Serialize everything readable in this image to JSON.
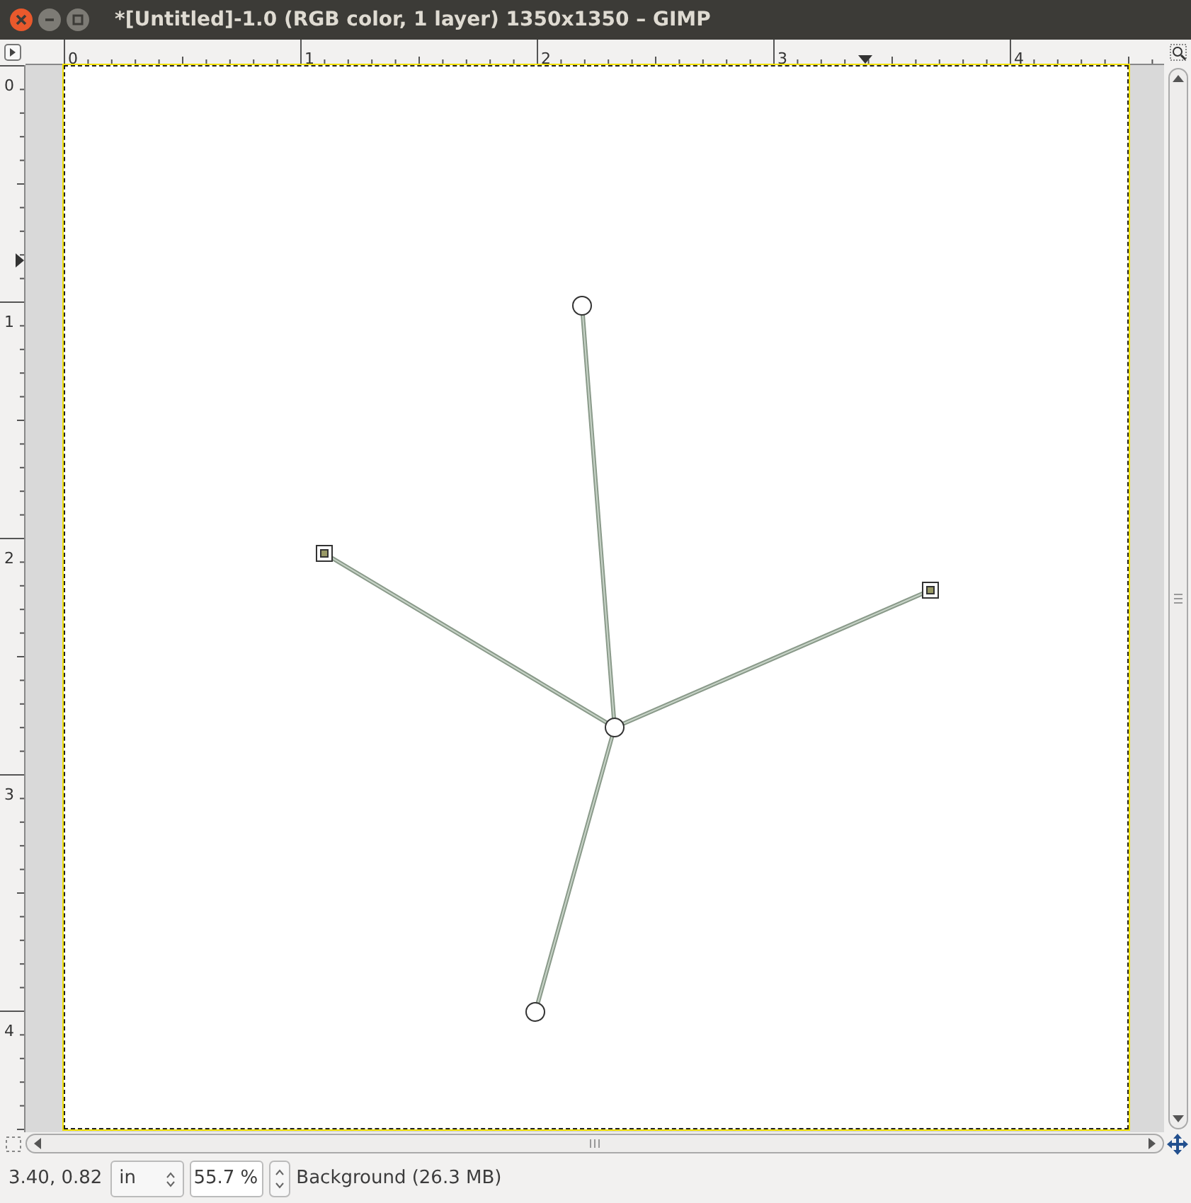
{
  "window": {
    "title": "*[Untitled]-1.0 (RGB color, 1 layer) 1350x1350 – GIMP"
  },
  "rulers": {
    "horizontal": [
      "0",
      "1",
      "2",
      "3",
      "4"
    ],
    "vertical": [
      "0",
      "1",
      "2",
      "3",
      "4"
    ]
  },
  "status_bar": {
    "pointer": "3.40, 0.82",
    "unit": "in",
    "zoom": "55.7 %",
    "layer": "Background (26.3 MB)"
  }
}
